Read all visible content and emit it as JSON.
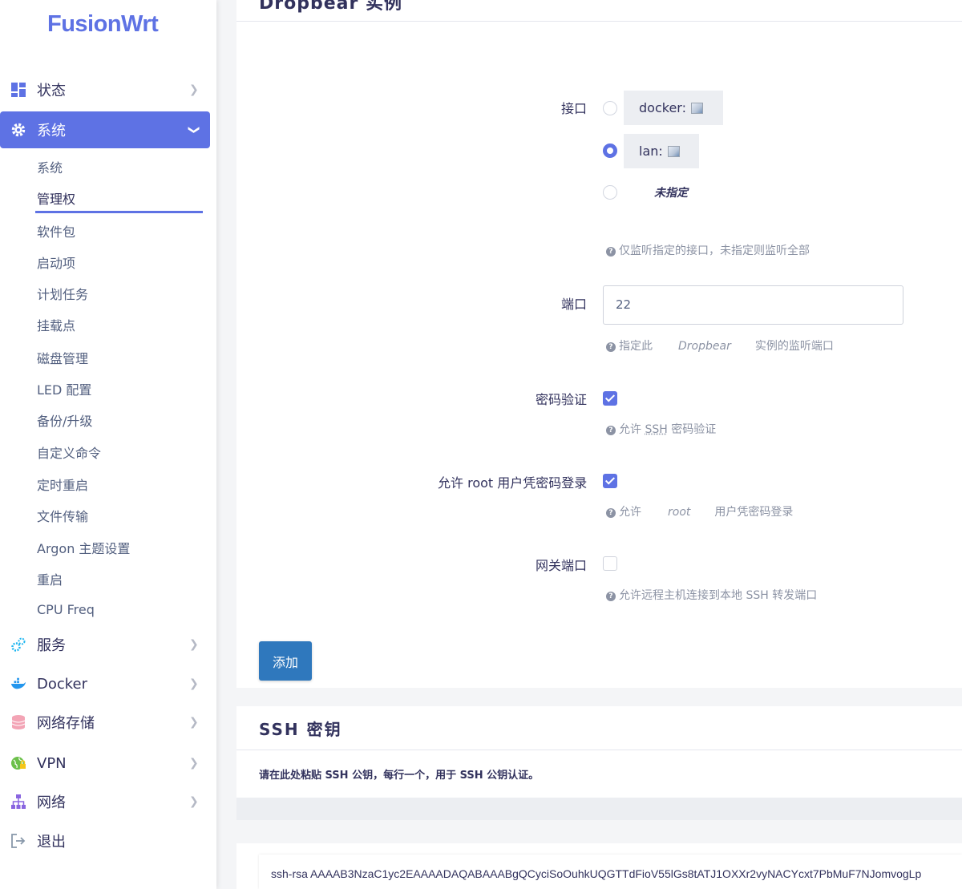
{
  "sidebar": {
    "logo": "FusionWrt",
    "nav": [
      {
        "label": "状态",
        "icon": "dashboard-icon"
      },
      {
        "label": "系统",
        "icon": "gear-icon"
      },
      {
        "label": "服务",
        "icon": "gears-icon"
      },
      {
        "label": "Docker",
        "icon": "docker-whale-icon"
      },
      {
        "label": "网络存储",
        "icon": "database-icon"
      },
      {
        "label": "VPN",
        "icon": "globe-lock-icon"
      },
      {
        "label": "网络",
        "icon": "sitemap-icon"
      },
      {
        "label": "退出",
        "icon": "logout-icon"
      }
    ],
    "system_sub": [
      "系统",
      "管理权",
      "软件包",
      "启动项",
      "计划任务",
      "挂载点",
      "磁盘管理",
      "LED 配置",
      "备份/升级",
      "自定义命令",
      "定时重启",
      "文件传输",
      "Argon 主题设置",
      "重启",
      "CPU Freq"
    ],
    "active_sub": "管理权"
  },
  "main": {
    "section_title": "Dropbear 实例",
    "interface": {
      "label": "接口",
      "options": [
        {
          "label": "docker:",
          "selected": false
        },
        {
          "label": "lan:",
          "selected": true
        },
        {
          "label": "未指定",
          "selected": false
        }
      ],
      "hint": "仅监听指定的接口，未指定则监听全部"
    },
    "port": {
      "label": "端口",
      "value": "22",
      "hint_a": "指定此",
      "hint_b": "Dropbear",
      "hint_c": "实例的监听端口"
    },
    "password_auth": {
      "label": "密码验证",
      "checked": true,
      "hint_a": "允许",
      "hint_b": "SSH",
      "hint_c": "密码验证"
    },
    "root_password": {
      "label": "允许 root 用户凭密码登录",
      "checked": true,
      "hint_a": "允许",
      "hint_b": "root",
      "hint_c": "用户凭密码登录"
    },
    "gateway_ports": {
      "label": "网关端口",
      "checked": false,
      "hint": "允许远程主机连接到本地 SSH 转发端口"
    },
    "add_button": "添加"
  },
  "ssh_keys": {
    "title": "SSH 密钥",
    "description": "请在此处粘贴 SSH 公钥，每行一个，用于 SSH 公钥认证。",
    "key_text": "ssh-rsa AAAAB3NzaC1yc2EAAAADAQABAAABgQCyciSoOuhkUQGTTdFioV55lGs8tATJ1OXXr2vyNACYcxt7PbMuF7NJomvogLp"
  },
  "colors": {
    "accent": "#5e72e4",
    "button": "#2f78bd"
  }
}
